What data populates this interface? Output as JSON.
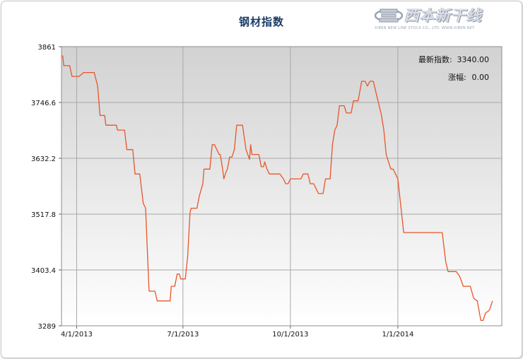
{
  "title": "钢材指数",
  "logo": {
    "text": "西本新干线",
    "subtext": "XIBEN NEW LINE STOCK CO., LTD.  WWW.XIBEN.NET"
  },
  "info": {
    "index_label": "最新指数:",
    "index_value": "3340.00",
    "change_label": "涨幅:",
    "change_value": "0.00"
  },
  "colors": {
    "line": "#e8552a",
    "title": "#1c3d66",
    "plot_top": "#d2d2d2",
    "plot_bottom": "#ffffff"
  },
  "chart_data": {
    "type": "line",
    "title": "钢材指数",
    "xlabel": "",
    "ylabel": "",
    "y_ticks": [
      "3289",
      "3403.4",
      "3517.8",
      "3632.2",
      "3746.6",
      "3861"
    ],
    "ylim": [
      3289,
      3861
    ],
    "x_tick_labels": [
      "4/1/2013",
      "7/1/2013",
      "10/1/2013",
      "1/1/2014"
    ],
    "x_tick_dates": [
      "2013-04-01",
      "2013-07-01",
      "2013-10-01",
      "2014-01-01"
    ],
    "x_range": [
      "2013-03-19",
      "2014-03-31"
    ],
    "grid": true,
    "series": [
      {
        "points": [
          [
            "2013-03-19",
            3842
          ],
          [
            "2013-03-20",
            3842
          ],
          [
            "2013-03-21",
            3822
          ],
          [
            "2013-03-26",
            3822
          ],
          [
            "2013-03-28",
            3800
          ],
          [
            "2013-04-03",
            3800
          ],
          [
            "2013-04-07",
            3808
          ],
          [
            "2013-04-16",
            3808
          ],
          [
            "2013-04-19",
            3780
          ],
          [
            "2013-04-21",
            3720
          ],
          [
            "2013-04-25",
            3720
          ],
          [
            "2013-04-26",
            3700
          ],
          [
            "2013-05-05",
            3700
          ],
          [
            "2013-05-06",
            3690
          ],
          [
            "2013-05-12",
            3690
          ],
          [
            "2013-05-14",
            3650
          ],
          [
            "2013-05-19",
            3650
          ],
          [
            "2013-05-21",
            3600
          ],
          [
            "2013-05-25",
            3600
          ],
          [
            "2013-05-28",
            3540
          ],
          [
            "2013-05-30",
            3530
          ],
          [
            "2013-06-02",
            3360
          ],
          [
            "2013-06-07",
            3360
          ],
          [
            "2013-06-09",
            3340
          ],
          [
            "2013-06-20",
            3340
          ],
          [
            "2013-06-21",
            3370
          ],
          [
            "2013-06-24",
            3370
          ],
          [
            "2013-06-26",
            3395
          ],
          [
            "2013-06-28",
            3395
          ],
          [
            "2013-06-29",
            3385
          ],
          [
            "2013-07-03",
            3385
          ],
          [
            "2013-07-05",
            3430
          ],
          [
            "2013-07-07",
            3520
          ],
          [
            "2013-07-08",
            3530
          ],
          [
            "2013-07-13",
            3530
          ],
          [
            "2013-07-15",
            3555
          ],
          [
            "2013-07-18",
            3580
          ],
          [
            "2013-07-19",
            3610
          ],
          [
            "2013-07-24",
            3610
          ],
          [
            "2013-07-26",
            3660
          ],
          [
            "2013-07-28",
            3660
          ],
          [
            "2013-08-01",
            3640
          ],
          [
            "2013-08-02",
            3640
          ],
          [
            "2013-08-04",
            3610
          ],
          [
            "2013-08-05",
            3590
          ],
          [
            "2013-08-07",
            3605
          ],
          [
            "2013-08-08",
            3610
          ],
          [
            "2013-08-10",
            3635
          ],
          [
            "2013-08-12",
            3635
          ],
          [
            "2013-08-14",
            3650
          ],
          [
            "2013-08-16",
            3700
          ],
          [
            "2013-08-21",
            3700
          ],
          [
            "2013-08-24",
            3650
          ],
          [
            "2013-08-27",
            3630
          ],
          [
            "2013-08-28",
            3660
          ],
          [
            "2013-08-29",
            3640
          ],
          [
            "2013-09-04",
            3640
          ],
          [
            "2013-09-06",
            3615
          ],
          [
            "2013-09-08",
            3615
          ],
          [
            "2013-09-09",
            3625
          ],
          [
            "2013-09-11",
            3610
          ],
          [
            "2013-09-13",
            3600
          ],
          [
            "2013-09-22",
            3600
          ],
          [
            "2013-09-25",
            3590
          ],
          [
            "2013-09-27",
            3580
          ],
          [
            "2013-09-29",
            3580
          ],
          [
            "2013-10-01",
            3590
          ],
          [
            "2013-10-10",
            3590
          ],
          [
            "2013-10-12",
            3600
          ],
          [
            "2013-10-16",
            3600
          ],
          [
            "2013-10-18",
            3580
          ],
          [
            "2013-10-21",
            3580
          ],
          [
            "2013-10-23",
            3570
          ],
          [
            "2013-10-25",
            3560
          ],
          [
            "2013-10-29",
            3560
          ],
          [
            "2013-10-31",
            3590
          ],
          [
            "2013-11-04",
            3590
          ],
          [
            "2013-11-06",
            3660
          ],
          [
            "2013-11-08",
            3690
          ],
          [
            "2013-11-10",
            3700
          ],
          [
            "2013-11-12",
            3740
          ],
          [
            "2013-11-16",
            3740
          ],
          [
            "2013-11-18",
            3725
          ],
          [
            "2013-11-22",
            3725
          ],
          [
            "2013-11-24",
            3750
          ],
          [
            "2013-11-28",
            3750
          ],
          [
            "2013-12-01",
            3790
          ],
          [
            "2013-12-04",
            3790
          ],
          [
            "2013-12-06",
            3780
          ],
          [
            "2013-12-08",
            3790
          ],
          [
            "2013-12-11",
            3790
          ],
          [
            "2013-12-13",
            3770
          ],
          [
            "2013-12-16",
            3740
          ],
          [
            "2013-12-18",
            3720
          ],
          [
            "2013-12-20",
            3690
          ],
          [
            "2013-12-22",
            3640
          ],
          [
            "2013-12-26",
            3610
          ],
          [
            "2013-12-28",
            3610
          ],
          [
            "2014-01-01",
            3590
          ],
          [
            "2014-01-06",
            3480
          ],
          [
            "2014-02-08",
            3480
          ],
          [
            "2014-02-11",
            3420
          ],
          [
            "2014-02-13",
            3400
          ],
          [
            "2014-02-20",
            3400
          ],
          [
            "2014-02-23",
            3390
          ],
          [
            "2014-02-26",
            3370
          ],
          [
            "2014-03-04",
            3370
          ],
          [
            "2014-03-07",
            3345
          ],
          [
            "2014-03-10",
            3340
          ],
          [
            "2014-03-13",
            3300
          ],
          [
            "2014-03-15",
            3300
          ],
          [
            "2014-03-17",
            3315
          ],
          [
            "2014-03-20",
            3320
          ],
          [
            "2014-03-21",
            3325
          ],
          [
            "2014-03-23",
            3340
          ]
        ]
      }
    ]
  }
}
